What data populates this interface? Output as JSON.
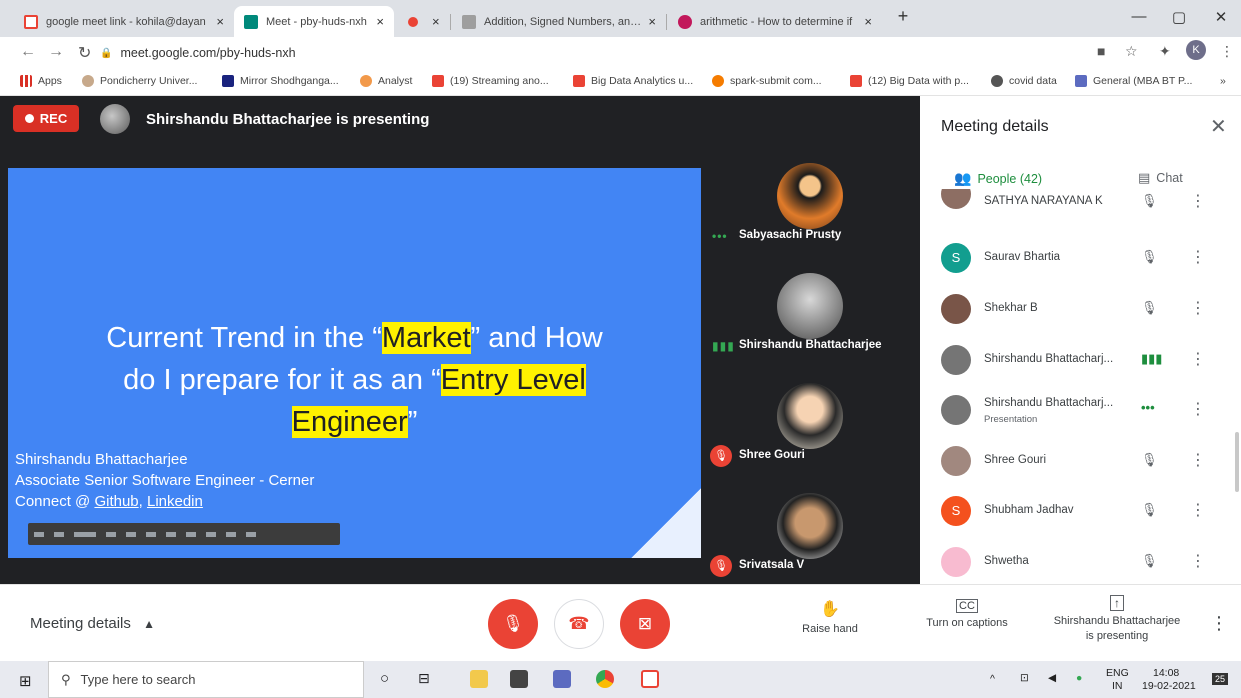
{
  "browser": {
    "tabs": [
      {
        "label": "google meet link - kohila@dayan",
        "color": "#ea4335"
      },
      {
        "label": "Meet - pby-huds-nxh",
        "color": "#00897b",
        "active": true
      },
      {
        "label": "",
        "color": "#ea4335"
      },
      {
        "label": "Addition, Signed Numbers, and C",
        "color": "#9e9e9e"
      },
      {
        "label": "arithmetic - How to determine if",
        "color": "#c2185b"
      }
    ],
    "new_tab": "+",
    "close_glyph": "×",
    "win_min": "—",
    "win_max": "▢",
    "win_close": "✕",
    "url": "meet.google.com/pby-huds-nxh",
    "profile_initial": "K",
    "bookmarks": [
      {
        "label": "Apps",
        "color": "#d93025"
      },
      {
        "label": "Pondicherry Univer...",
        "color": "#a0a0a0"
      },
      {
        "label": "Mirror Shodhganga...",
        "color": "#1a237e"
      },
      {
        "label": "Analyst",
        "color": "#f2994a"
      },
      {
        "label": "(19) Streaming ano...",
        "color": "#ea4335"
      },
      {
        "label": "Big Data Analytics u...",
        "color": "#ea4335"
      },
      {
        "label": "spark-submit com...",
        "color": "#f57c00"
      },
      {
        "label": "(12) Big Data with p...",
        "color": "#ea4335"
      },
      {
        "label": "covid data",
        "color": "#555555"
      },
      {
        "label": "General (MBA BT P...",
        "color": "#5c6bc0"
      }
    ],
    "bookmarks_more": "»"
  },
  "meet": {
    "rec_label": "REC",
    "presenting_banner": "Shirshandu Bhattacharjee is presenting",
    "slide": {
      "line1_a": "Current Trend in the “",
      "line1_hl": "Market",
      "line1_b": "” and How",
      "line2_a": "do I prepare for it as an “",
      "line2_hl": "Entry Level",
      "line3_hl": "Engineer",
      "line3_b": "”",
      "author": "Shirshandu Bhattacharjee",
      "role": "Associate Senior Software Engineer - Cerner",
      "connect_prefix": "Connect @ ",
      "github": "Github",
      "sep": ", ",
      "linkedin": "Linkedin"
    },
    "tiles": [
      {
        "name": "Sabyasachi Prusty",
        "status": "talking"
      },
      {
        "name": "Shirshandu Bhattacharjee",
        "status": "speaking"
      },
      {
        "name": "Shree Gouri",
        "status": "muted"
      },
      {
        "name": "Srivatsala V",
        "status": "muted"
      }
    ]
  },
  "panel": {
    "title": "Meeting details",
    "tab_people": "People (42)",
    "tab_chat": "Chat",
    "people": [
      {
        "name": "SATHYA NARAYANA K",
        "sub": "",
        "initial": "",
        "color": "#8d6e63",
        "mic": "muted"
      },
      {
        "name": "Saurav Bhartia",
        "sub": "",
        "initial": "S",
        "color": "#129e8f",
        "mic": "muted"
      },
      {
        "name": "Shekhar B",
        "sub": "",
        "initial": "",
        "color": "#795548",
        "mic": "muted"
      },
      {
        "name": "Shirshandu Bhattacharj...",
        "sub": "",
        "initial": "",
        "color": "#757575",
        "mic": "speaking"
      },
      {
        "name": "Shirshandu Bhattacharj...",
        "sub": "Presentation",
        "initial": "",
        "color": "#757575",
        "mic": "dots"
      },
      {
        "name": "Shree Gouri",
        "sub": "",
        "initial": "",
        "color": "#a1887f",
        "mic": "muted"
      },
      {
        "name": "Shubham Jadhav",
        "sub": "",
        "initial": "S",
        "color": "#f4511e",
        "mic": "muted"
      },
      {
        "name": "Shwetha",
        "sub": "",
        "initial": "",
        "color": "#f8bbd0",
        "mic": "muted"
      }
    ]
  },
  "bottom": {
    "meeting_details": "Meeting details",
    "raise_hand": "Raise hand",
    "captions": "Turn on captions",
    "presenting_line1": "Shirshandu Bhattacharjee",
    "presenting_line2": "is presenting"
  },
  "taskbar": {
    "search_placeholder": "Type here to search",
    "lang_line1": "ENG",
    "lang_line2": "IN",
    "time": "14:08",
    "date": "19-02-2021",
    "notif_count": "25"
  }
}
